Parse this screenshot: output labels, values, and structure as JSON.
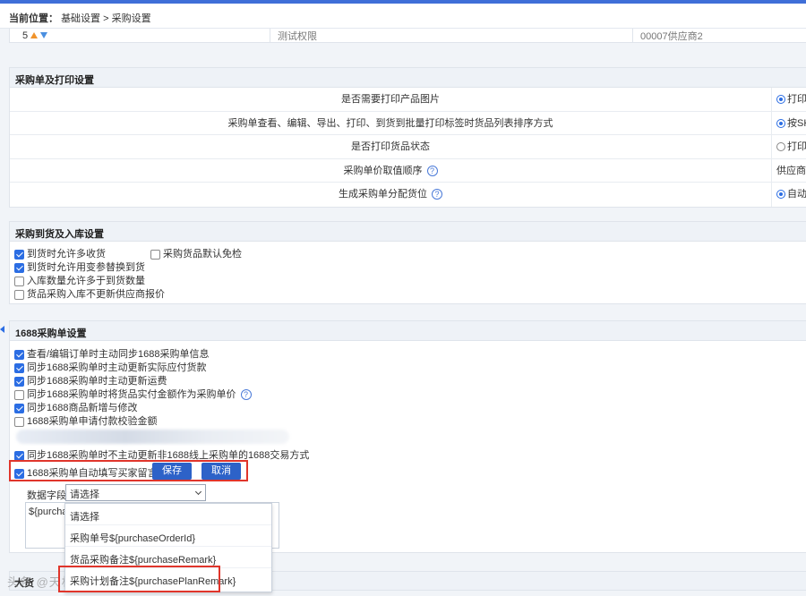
{
  "breadcrumb": {
    "label": "当前位置：",
    "path": "基础设置 > 采购设置"
  },
  "top_row": {
    "index": "5",
    "col2": "测试权限",
    "col3": "00007供应商2"
  },
  "print_settings": {
    "title": "采购单及打印设置",
    "rows": [
      {
        "label": "是否需要打印产品图片",
        "value": "打印",
        "control": "radio-on"
      },
      {
        "label": "采购单查看、编辑、导出、打印、到货到批量打印标签时货品列表排序方式",
        "value": "按SK",
        "control": "radio-on"
      },
      {
        "label": "是否打印货品状态",
        "value": "打印",
        "control": "radio-off"
      },
      {
        "label": "采购单价取值顺序",
        "value": "供应商",
        "control": "text",
        "help": "?"
      },
      {
        "label": "生成采购单分配货位",
        "value": "自动",
        "control": "radio-on",
        "help": "?"
      }
    ]
  },
  "arrival_settings": {
    "title": "采购到货及入库设置",
    "items": [
      {
        "label": "到货时允许多收货",
        "checked": true
      },
      {
        "label": "采购货品默认免检",
        "checked": false
      },
      {
        "label": "到货时允许用变参替换到货",
        "checked": true
      },
      {
        "label": "入库数量允许多于到货数量",
        "checked": false
      },
      {
        "label": "货品采购入库不更新供应商报价",
        "checked": false
      }
    ]
  },
  "settings_1688": {
    "title": "1688采购单设置",
    "items": [
      {
        "label": "查看/编辑订单时主动同步1688采购单信息",
        "checked": true
      },
      {
        "label": "同步1688采购单时主动更新实际应付货款",
        "checked": true
      },
      {
        "label": "同步1688采购单时主动更新运费",
        "checked": true
      },
      {
        "label": "同步1688采购单时将货品实付金额作为采购单价",
        "checked": false,
        "help": "?"
      },
      {
        "label": "同步1688商品新增与修改",
        "checked": true
      },
      {
        "label": "1688采购单申请付款校验金额",
        "checked": false
      },
      {
        "label": "同步1688采购单时不主动更新非1688线上采购单的1688交易方式",
        "checked": true
      }
    ],
    "remark_option": {
      "label": "1688采购单自动填写买家留言",
      "checked": true
    },
    "save_label": "保存",
    "cancel_label": "取消",
    "field_label": "数据字段:",
    "select_value": "请选择",
    "textarea_value": "${purchase",
    "dropdown_options": [
      "请选择",
      "采购单号${purchaseOrderId}",
      "货品采购备注${purchaseRemark}",
      "采购计划备注${purchasePlanRemark}"
    ]
  },
  "bottom_section": {
    "title": "大货"
  },
  "watermark": "头条 @天材科技",
  "colors": {
    "accent": "#2d62c8",
    "highlight_box": "#e0352b"
  }
}
